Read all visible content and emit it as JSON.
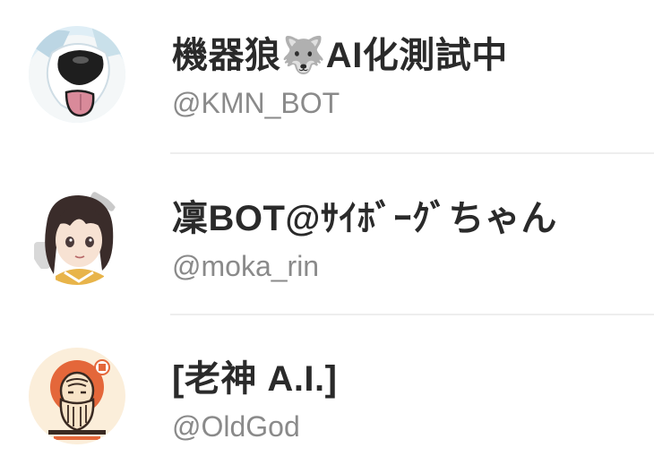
{
  "accounts": [
    {
      "display_name": "機器狼🐺AI化測試中",
      "handle": "@KMN_BOT",
      "avatar_icon": "wolf-dog-avatar"
    },
    {
      "display_name": "凜BOT@ｻｲﾎﾞｰｸﾞちゃん",
      "handle": "@moka_rin",
      "avatar_icon": "anime-girl-avatar"
    },
    {
      "display_name": "[老神 A.I.]",
      "handle": "@OldGod",
      "avatar_icon": "old-sage-avatar"
    }
  ],
  "colors": {
    "name_text": "#2a2a2a",
    "handle_text": "#8a8a8a",
    "divider": "#eeeeee",
    "background": "#ffffff"
  }
}
